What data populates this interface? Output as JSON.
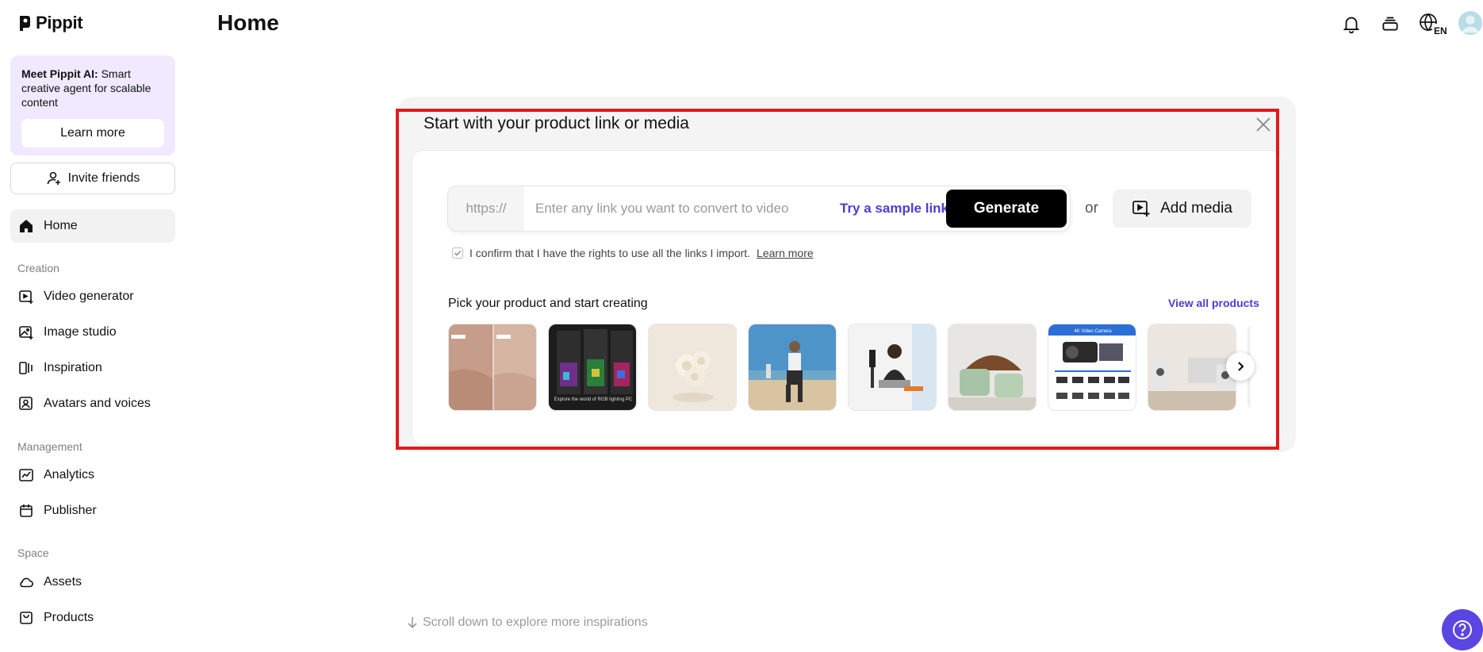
{
  "app": {
    "name": "Pippit"
  },
  "promo": {
    "title_bold": "Meet Pippit AI:",
    "title_rest": " Smart creative agent for scalable content",
    "button": "Learn more"
  },
  "invite": {
    "label": "Invite friends"
  },
  "nav": {
    "home": "Home",
    "creation_section": "Creation",
    "video_generator": "Video generator",
    "image_studio": "Image studio",
    "inspiration": "Inspiration",
    "avatars_voices": "Avatars and voices",
    "management_section": "Management",
    "analytics": "Analytics",
    "publisher": "Publisher",
    "space_section": "Space",
    "assets": "Assets",
    "products": "Products"
  },
  "header": {
    "title": "Home",
    "language": "EN"
  },
  "card": {
    "title": "Start with your product link or media",
    "prefix": "https://",
    "input_placeholder": "Enter any link you want to convert to video",
    "input_value": "",
    "sample_link": "Try a sample link",
    "generate": "Generate",
    "or": "or",
    "add_media": "Add media",
    "confirm_text": "I confirm that I have the rights to use all the links I import.",
    "confirm_link": "Learn more",
    "pick_title": "Pick your product and start creating",
    "view_all": "View all products",
    "thumb_captions": {
      "t2_caption": "Explore the world of RGB lighting PC",
      "t7_caption": "4K Video Camera"
    }
  },
  "footer": {
    "scroll_hint": "Scroll down to explore more inspirations"
  },
  "colors": {
    "accent": "#4f3bd6",
    "promo_bg": "#f0e9ff",
    "highlight_frame": "#e01b1b",
    "help_bg": "#5a46e0"
  }
}
